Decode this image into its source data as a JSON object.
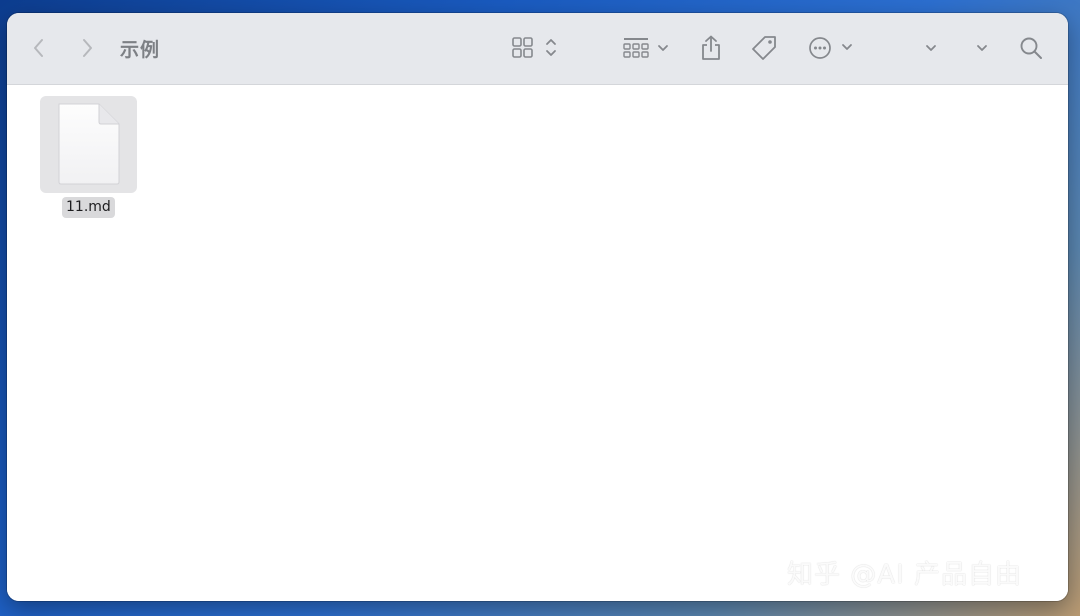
{
  "window": {
    "title": "示例"
  },
  "toolbar": {
    "back_icon": "chevron-left-icon",
    "forward_icon": "chevron-right-icon",
    "view_icon": "grid-view-icon",
    "group_icon": "group-by-icon",
    "share_icon": "share-icon",
    "tag_icon": "tag-icon",
    "more_icon": "ellipsis-circle-icon",
    "search_icon": "search-icon"
  },
  "files": [
    {
      "name": "11.md",
      "icon": "document-icon",
      "selected": true
    }
  ],
  "watermark": {
    "text": "知乎 @AI 产品自由"
  },
  "colors": {
    "toolbar_bg": "#e6e8ec",
    "icon_gray": "#85888d",
    "selection_bg": "#d9d9db"
  }
}
